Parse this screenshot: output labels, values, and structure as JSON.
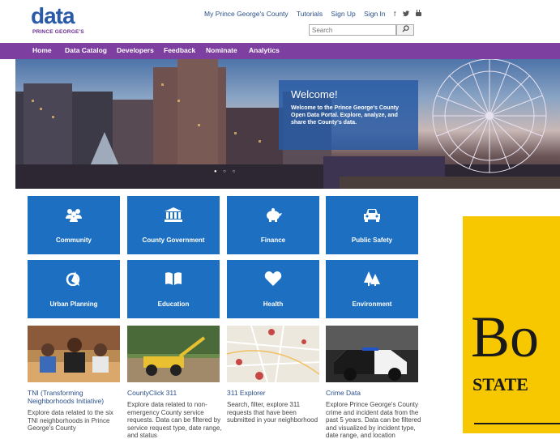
{
  "logo": {
    "word": "data",
    "subtitle": "PRINCE GEORGE'S"
  },
  "toplinks": {
    "county_link": "My Prince George's County",
    "tutorials": "Tutorials",
    "signup": "Sign Up",
    "signin": "Sign In",
    "facebook": "f",
    "twitter": "🐦",
    "youtube": "▣"
  },
  "search": {
    "placeholder": "Search",
    "button": "⌕"
  },
  "nav": [
    "Home",
    "Data Catalog",
    "Developers",
    "Feedback",
    "Nominate",
    "Analytics"
  ],
  "hero": {
    "title": "Welcome!",
    "text": "Welcome to the Prince George's County Open Data Portal. Explore, analyze, and share the County's data.",
    "dots": "● ○ ○"
  },
  "tiles": [
    {
      "label": "Community",
      "icon": "people-icon"
    },
    {
      "label": "County Government",
      "icon": "bank-icon"
    },
    {
      "label": "Finance",
      "icon": "piggy-bank-icon"
    },
    {
      "label": "Public Safety",
      "icon": "car-icon"
    },
    {
      "label": "Urban Planning",
      "icon": "compass-icon"
    },
    {
      "label": "Education",
      "icon": "book-icon"
    },
    {
      "label": "Health",
      "icon": "heart-icon"
    },
    {
      "label": "Environment",
      "icon": "trees-icon"
    }
  ],
  "cards": [
    {
      "title": "TNI (Transforming Neighborhoods Initiative)",
      "desc": "Explore data related to the six TNI neighborhoods in Prince George's County"
    },
    {
      "title": "CountyClick 311",
      "desc": "Explore data related to non-emergency County service requests. Data can be filtered by service request type, date range, and status"
    },
    {
      "title": "311 Explorer",
      "desc": "Search, filter, explore 311 requests that have been submitted in your neighborhood"
    },
    {
      "title": "Crime Data",
      "desc": "Explore Prince George's County crime and incident data from the past 5 years. Data can be filtered and visualized by incident type, date range, and location"
    }
  ],
  "ad": {
    "word": "Bo",
    "sub": "STATE"
  },
  "colors": {
    "nav": "#7d3fa0",
    "tile": "#1d6fc2",
    "link": "#2a4f8a",
    "ad": "#f7c800"
  }
}
